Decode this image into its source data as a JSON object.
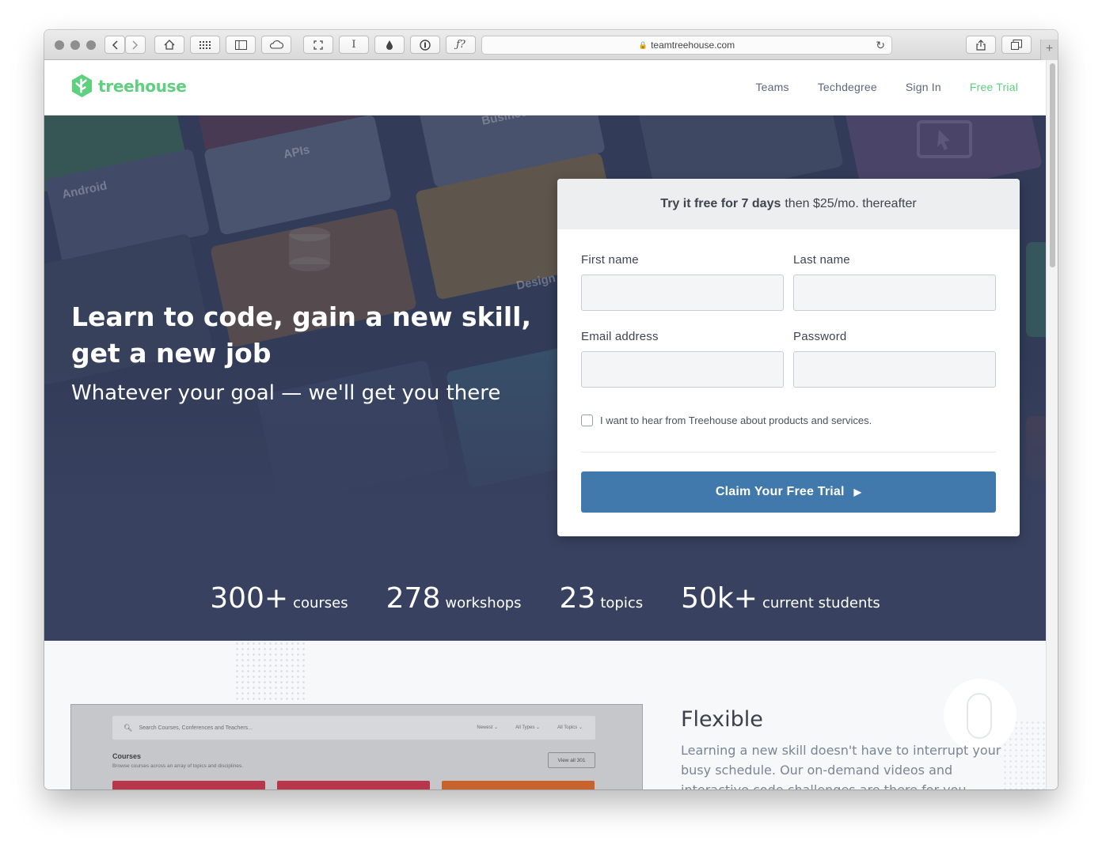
{
  "browser": {
    "url": "teamtreehouse.com",
    "new_tab_label": "+"
  },
  "site": {
    "logo_text": "treehouse",
    "brand_color": "#5fcf80",
    "nav": [
      {
        "label": "Teams"
      },
      {
        "label": "Techdegree"
      },
      {
        "label": "Sign In"
      },
      {
        "label": "Free Trial"
      }
    ]
  },
  "hero": {
    "headline": "Learn to code, gain a new skill, get a new job",
    "subhead": "Whatever your goal — we'll get you there",
    "tile_labels": [
      "Android",
      "APIs",
      "Business",
      "Design"
    ]
  },
  "form": {
    "header_bold": "Try it free for 7 days",
    "header_rest": "then $25/mo. thereafter",
    "first_name_label": "First name",
    "last_name_label": "Last name",
    "email_label": "Email address",
    "password_label": "Password",
    "opt_in_label": "I want to hear from Treehouse about products and services.",
    "cta_label": "Claim Your Free Trial",
    "cta_color": "#4179ad"
  },
  "stats": [
    {
      "number": "300+",
      "unit": "courses"
    },
    {
      "number": "278",
      "unit": "workshops"
    },
    {
      "number": "23",
      "unit": "topics"
    },
    {
      "number": "50k+",
      "unit": "current students"
    }
  ],
  "preview": {
    "search_placeholder": "Search Courses, Conferences and Teachers...",
    "filters": [
      "Newest ⌄",
      "All Types ⌄",
      "All Topics ⌄"
    ],
    "section_title": "Courses",
    "section_sub": "Browse courses across an array of topics and disciplines.",
    "view_all": "View all 301"
  },
  "feature": {
    "title": "Flexible",
    "body": "Learning a new skill doesn't have to interrupt your busy schedule. Our on-demand videos and interactive code challenges are there for you"
  }
}
